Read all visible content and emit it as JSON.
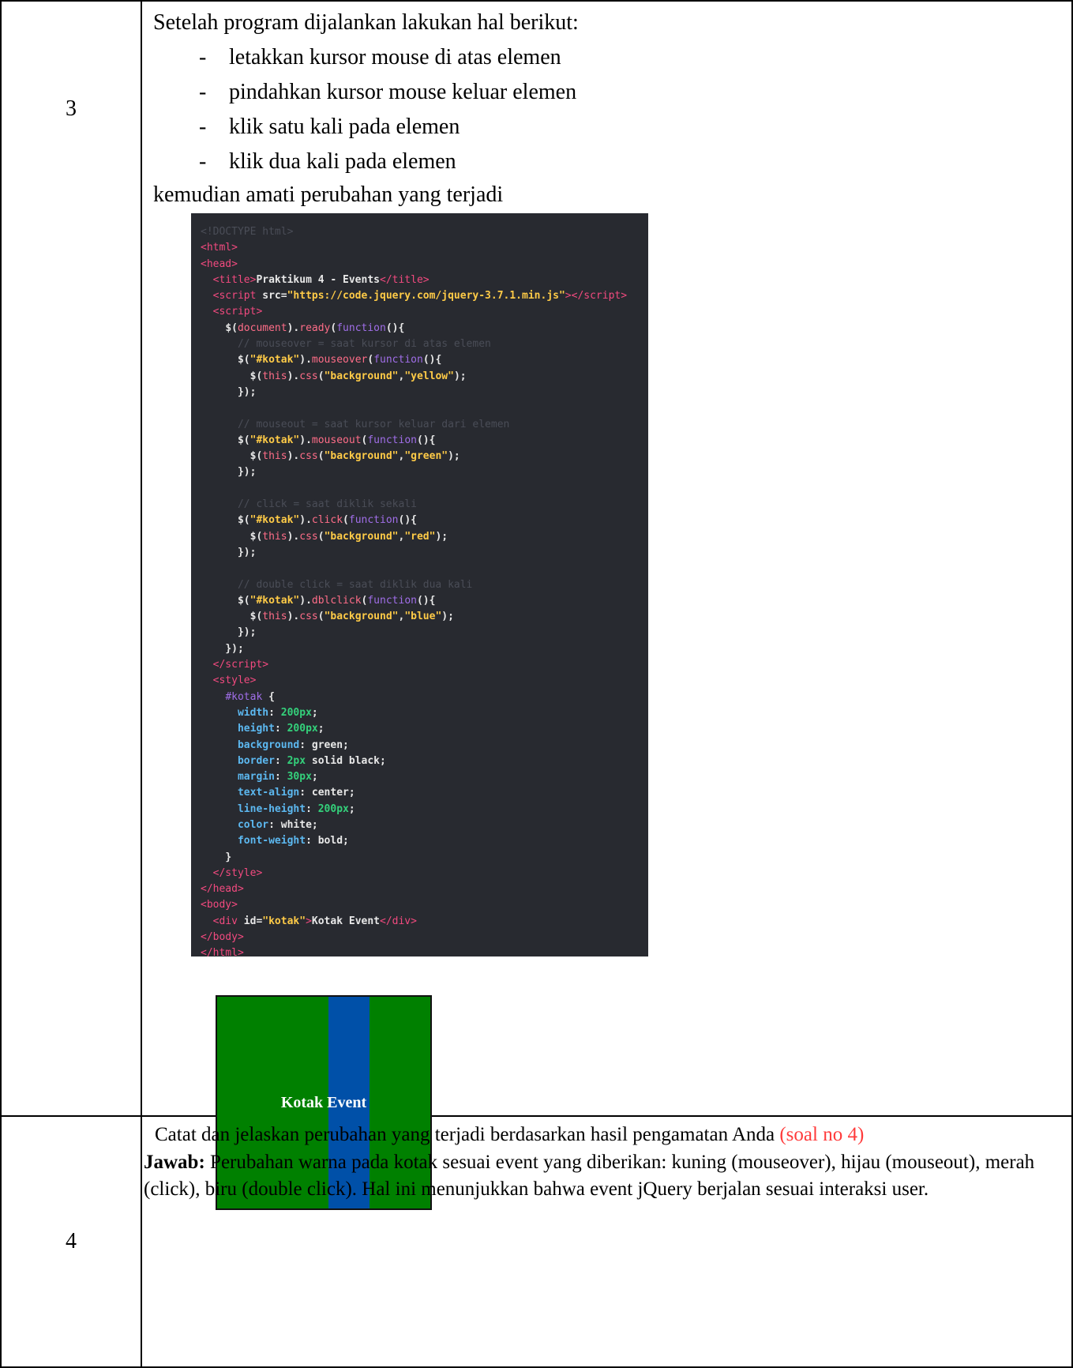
{
  "rows": [
    {
      "number": "3",
      "intro": "Setelah program dijalankan lakukan hal berikut:",
      "steps": [
        "letakkan kursor mouse di atas elemen",
        "pindahkan kursor mouse keluar elemen",
        "klik satu kali pada elemen",
        "klik dua kali pada elemen"
      ],
      "bullet": "-",
      "conclusion": "kemudian amati perubahan yang terjadi"
    },
    {
      "number": "4",
      "question": "Catat dan jelaskan perubahan yang terjadi berdasarkan hasil pengamatan Anda",
      "question_ref": "(soal no 4)",
      "answer_label": "Jawab:",
      "answer_text": "Perubahan warna pada kotak sesuai event yang diberikan: kuning (mouseover), hijau (mouseout), merah (click), biru (double click). Hal ini menunjukkan bahwa event jQuery berjalan sesuai interaksi user."
    }
  ],
  "demo_box": {
    "label": "Kotak Event",
    "background_color": "#008000",
    "stripe_color": "#0050a8"
  },
  "code": {
    "doctype": "<!DOCTYPE html>",
    "title_text": "Praktikum 4 - Events",
    "script_src": "\"https://code.jquery.com/jquery-3.7.1.min.js\"",
    "comment_mouseover": "// mouseover = saat kursor di atas elemen",
    "comment_mouseout": "// mouseout = saat kursor keluar dari elemen",
    "comment_click": "// click = saat diklik sekali",
    "comment_dblclick": "// double click = saat diklik dua kali",
    "selector": "\"#kotak\"",
    "prop_background": "\"background\"",
    "val_yellow": "\"yellow\"",
    "val_green": "\"green\"",
    "val_red": "\"red\"",
    "val_blue": "\"blue\"",
    "div_id": "\"kotak\"",
    "div_text": "Kotak Event"
  }
}
